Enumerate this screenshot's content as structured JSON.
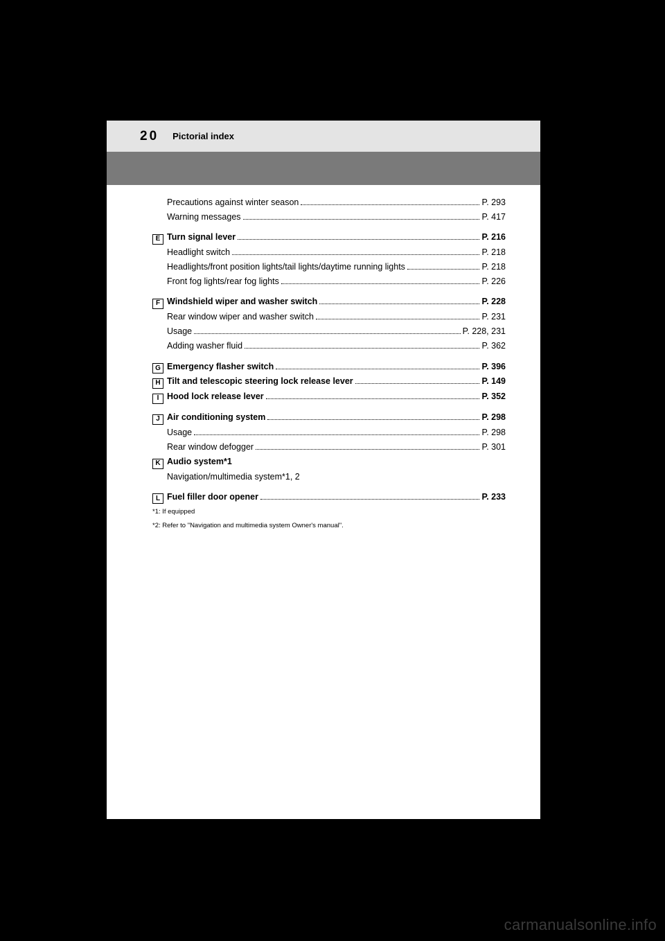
{
  "header": {
    "page_number": "20",
    "title": "Pictorial index"
  },
  "lines": [
    {
      "type": "sub",
      "label": "Precautions against winter season",
      "pref": "P. 293"
    },
    {
      "type": "sub",
      "label": "Warning messages",
      "pref": "P. 417"
    },
    {
      "type": "gap"
    },
    {
      "type": "key",
      "key": "E",
      "label": "Turn signal lever",
      "pref": "P. 216"
    },
    {
      "type": "sub",
      "label": "Headlight switch",
      "pref": "P. 218"
    },
    {
      "type": "sub",
      "label": "Headlights/front position lights/tail lights/daytime running lights",
      "pref": "P. 218"
    },
    {
      "type": "sub",
      "label": "Front fog lights/rear fog lights",
      "pref": "P. 226"
    },
    {
      "type": "gap"
    },
    {
      "type": "key",
      "key": "F",
      "label": "Windshield wiper and washer switch",
      "pref": "P. 228"
    },
    {
      "type": "sub",
      "label": "Rear window wiper and washer switch",
      "pref": "P. 231"
    },
    {
      "type": "sub",
      "label": "Usage",
      "pref": "P. 228, 231"
    },
    {
      "type": "sub",
      "label": "Adding washer fluid",
      "pref": "P. 362"
    },
    {
      "type": "gap"
    },
    {
      "type": "key",
      "key": "G",
      "label": "Emergency flasher switch",
      "pref": "P. 396"
    },
    {
      "type": "key",
      "key": "H",
      "label": "Tilt and telescopic steering lock release lever",
      "pref": "P. 149"
    },
    {
      "type": "key",
      "key": "I",
      "label": "Hood lock release lever",
      "pref": "P. 352"
    },
    {
      "type": "gap"
    },
    {
      "type": "key",
      "key": "J",
      "label": "Air conditioning system",
      "pref": "P. 298"
    },
    {
      "type": "sub",
      "label": "Usage",
      "pref": "P. 298"
    },
    {
      "type": "sub",
      "label": "Rear window defogger",
      "pref": "P. 301"
    },
    {
      "type": "key",
      "key": "K",
      "label": "Audio system*1",
      "pref": ""
    },
    {
      "type": "sub",
      "label": "Navigation/multimedia system*1, 2",
      "pref": ""
    },
    {
      "type": "gap"
    },
    {
      "type": "key",
      "key": "L",
      "label": "Fuel filler door opener",
      "pref": "P. 233"
    }
  ],
  "notes": [
    "*1: If equipped",
    "*2: Refer to \"Navigation and multimedia system Owner's manual\"."
  ],
  "watermark": "carmanualsonline.info"
}
